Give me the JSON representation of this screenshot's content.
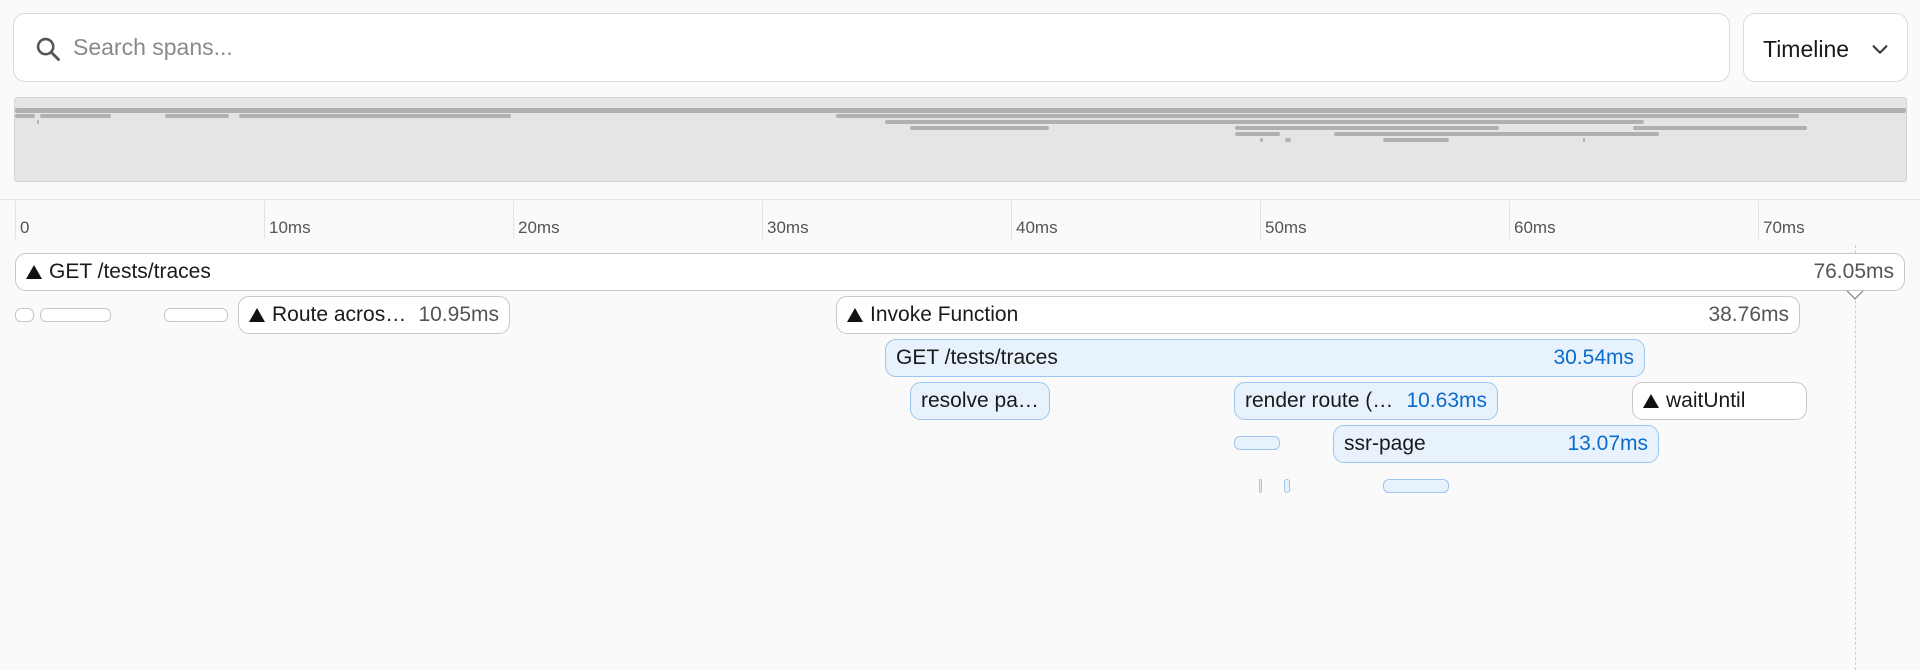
{
  "search": {
    "placeholder": "Search spans..."
  },
  "view_select": {
    "selected": "Timeline"
  },
  "ruler": {
    "ticks": [
      "0",
      "10ms",
      "20ms",
      "30ms",
      "40ms",
      "50ms",
      "60ms",
      "70ms"
    ]
  },
  "spans": {
    "root": {
      "name": "GET /tests/traces",
      "duration": "76.05ms",
      "start_ms": 0,
      "end_ms": 76.05
    },
    "route": {
      "name": "Route across multiple regions",
      "duration": "10.95ms",
      "start_ms": 9.0,
      "end_ms": 19.95
    },
    "invoke": {
      "name": "Invoke Function",
      "duration": "38.76ms",
      "start_ms": 33.0,
      "end_ms": 71.76
    },
    "get_inner": {
      "name": "GET /tests/traces",
      "duration": "30.54ms",
      "start_ms": 35.0,
      "end_ms": 65.54
    },
    "resolve": {
      "name": "resolve page components"
    },
    "render_route": {
      "name": "render route (app)",
      "duration": "10.63ms",
      "start_ms": 49.0,
      "end_ms": 59.63
    },
    "wait_until": {
      "name": "waitUntil"
    },
    "ssr_page": {
      "name": "ssr-page",
      "duration": "13.07ms",
      "start_ms": 53.0,
      "end_ms": 66.07
    }
  },
  "colors": {
    "accent_blue": "#0b6bcb",
    "span_blue_bg": "#e8f2fc",
    "span_blue_border": "#9cc6ef",
    "span_gray_border": "#c7c7c7",
    "minimap_bg": "#e5e5e5"
  },
  "icons": {
    "search": "search-icon",
    "chevron": "chevron-down-icon",
    "error_marker": "triangle-icon"
  }
}
